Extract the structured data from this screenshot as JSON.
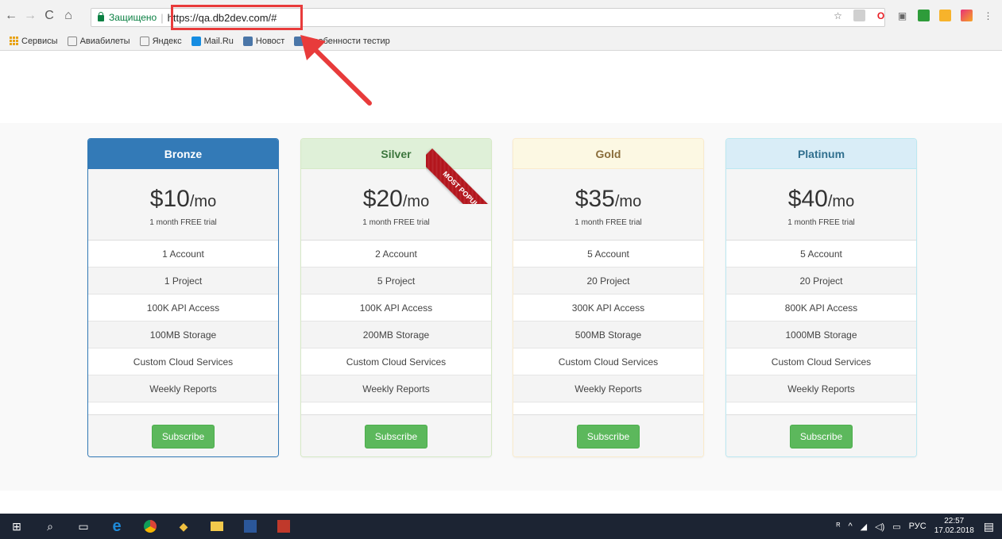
{
  "browser": {
    "secure_label": "Защищено",
    "url": "https://qa.db2dev.com/#",
    "bookmarks": [
      "Сервисы",
      "Авиабилеты",
      "Яндекс",
      "Mail.Ru",
      "Новост",
      "Особенности тестир"
    ]
  },
  "plans": [
    {
      "name": "Bronze",
      "price": "$10",
      "period": "/mo",
      "trial": "1 month FREE trial",
      "features": [
        "1 Account",
        "1 Project",
        "100K API Access",
        "100MB Storage",
        "Custom Cloud Services",
        "Weekly Reports"
      ],
      "button": "Subscribe"
    },
    {
      "name": "Silver",
      "price": "$20",
      "period": "/mo",
      "trial": "1 month FREE trial",
      "features": [
        "2 Account",
        "5 Project",
        "100K API Access",
        "200MB Storage",
        "Custom Cloud Services",
        "Weekly Reports"
      ],
      "button": "Subscribe",
      "ribbon": "MOST POPULR"
    },
    {
      "name": "Gold",
      "price": "$35",
      "period": "/mo",
      "trial": "1 month FREE trial",
      "features": [
        "5 Account",
        "20 Project",
        "300K API Access",
        "500MB Storage",
        "Custom Cloud Services",
        "Weekly Reports"
      ],
      "button": "Subscribe"
    },
    {
      "name": "Platinum",
      "price": "$40",
      "period": "/mo",
      "trial": "1 month FREE trial",
      "features": [
        "5 Account",
        "20 Project",
        "800K API Access",
        "1000MB Storage",
        "Custom Cloud Services",
        "Weekly Reports"
      ],
      "button": "Subscribe"
    }
  ],
  "taskbar": {
    "language": "РУС",
    "time": "22:57",
    "date": "17.02.2018"
  },
  "colors": {
    "highlight": "#e83b3b",
    "subscribe": "#5cb85c",
    "bronze": "#337ab7",
    "ribbon": "#b3161d"
  }
}
